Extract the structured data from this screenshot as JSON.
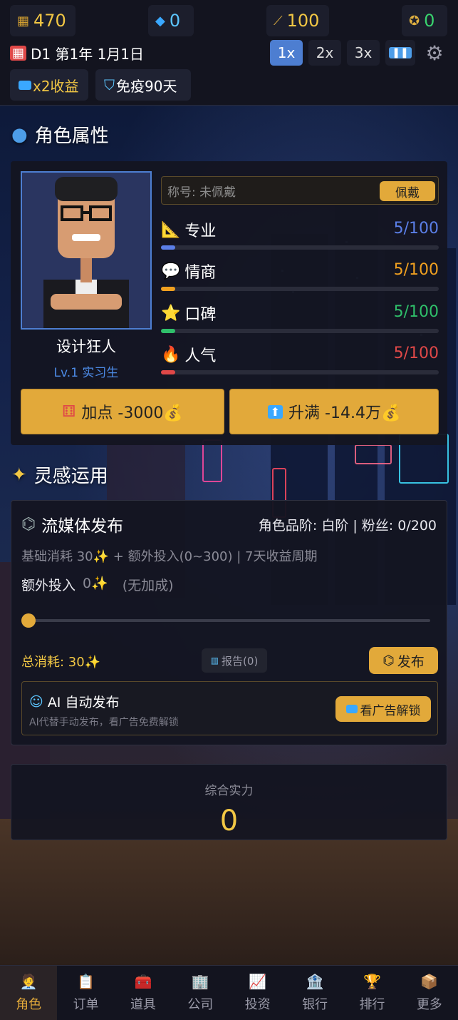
{
  "resources": {
    "coins": {
      "value": "470",
      "icon": "coin-stack-icon"
    },
    "diamonds": {
      "value": "0",
      "icon": "diamond-icon"
    },
    "inspiration": {
      "value": "100",
      "icon": "wand-icon"
    },
    "medals": {
      "value": "0",
      "icon": "medal-icon"
    }
  },
  "date": {
    "icon": "calendar-icon",
    "text": "D1 第1年 1月1日"
  },
  "speed": {
    "options": [
      "1x",
      "2x",
      "3x"
    ],
    "active": "1x",
    "pause_icon": "pause-icon",
    "settings_icon": "gear-icon"
  },
  "boosts": [
    {
      "icon": "tv-icon",
      "label": "x2收益"
    },
    {
      "icon": "shield-icon",
      "label": "免疫90天"
    }
  ],
  "character_section": {
    "title": "角色属性",
    "icon": "person-icon"
  },
  "character": {
    "name": "设计狂人",
    "level": "Lv.1 实习生",
    "title_placeholder": "称号: 未佩戴",
    "wear_label": "佩戴",
    "stats": [
      {
        "icon": "ruler-icon",
        "glyph": "📐",
        "label": "专业",
        "value": "5/100",
        "ratio": 0.05,
        "color": "#5b7fe8"
      },
      {
        "icon": "speech-icon",
        "glyph": "💬",
        "label": "情商",
        "value": "5/100",
        "ratio": 0.05,
        "color": "#f0a020"
      },
      {
        "icon": "star-icon",
        "glyph": "⭐",
        "label": "口碑",
        "value": "5/100",
        "ratio": 0.05,
        "color": "#2fbf6a"
      },
      {
        "icon": "fire-icon",
        "glyph": "🔥",
        "label": "人气",
        "value": "5/100",
        "ratio": 0.05,
        "color": "#e04848"
      }
    ],
    "add_point_label": "加点 -3000💰",
    "max_up_label": "升满 -14.4万💰"
  },
  "inspiration_section": {
    "title": "灵感运用",
    "icon": "sparkle-icon"
  },
  "stream": {
    "title": "流媒体发布",
    "icon": "satellite-icon",
    "rank_info": "角色品阶: 白阶 | 粉丝: 0/200",
    "cost_info": "基础消耗 30✨ + 额外投入(0~300) | 7天收益周期",
    "extra_label": "额外投入",
    "extra_value": "0✨",
    "extra_note": "(无加成)",
    "slider_value": 0,
    "total_label": "总消耗: 30✨",
    "report_label": "报告(0)",
    "report_icon": "chart-icon",
    "publish_label": "发布",
    "ai_title": "AI 自动发布",
    "ai_icon": "robot-icon",
    "ai_desc": "AI代替手动发布，看广告免费解锁",
    "ad_unlock_label": "看广告解锁"
  },
  "power": {
    "label": "综合实力",
    "value": "0"
  },
  "nav": [
    {
      "label": "角色",
      "icon": "character-icon",
      "glyph": "🧑‍💼",
      "active": true
    },
    {
      "label": "订单",
      "icon": "clipboard-icon",
      "glyph": "📋",
      "active": false
    },
    {
      "label": "道具",
      "icon": "items-icon",
      "glyph": "🧰",
      "active": false
    },
    {
      "label": "公司",
      "icon": "company-icon",
      "glyph": "🏢",
      "active": false
    },
    {
      "label": "投资",
      "icon": "invest-icon",
      "glyph": "📈",
      "active": false
    },
    {
      "label": "银行",
      "icon": "bank-icon",
      "glyph": "🏦",
      "active": false
    },
    {
      "label": "排行",
      "icon": "trophy-icon",
      "glyph": "🏆",
      "active": false
    },
    {
      "label": "更多",
      "icon": "box-icon",
      "glyph": "📦",
      "active": false
    }
  ],
  "colors": {
    "accent_gold": "#e2a93a",
    "accent_blue": "#4d7ed1",
    "coin_text": "#f2c744",
    "diamond_text": "#5cc6ff",
    "medal_text": "#39d36e"
  }
}
